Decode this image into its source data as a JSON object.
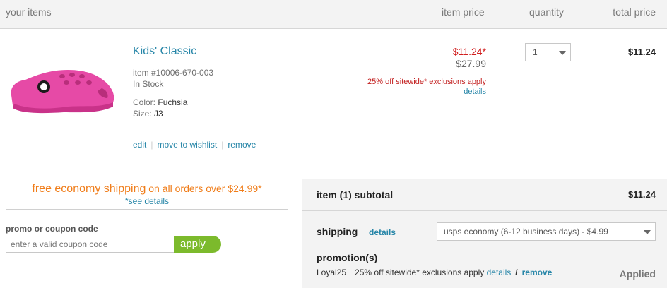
{
  "header": {
    "your_items": "your items",
    "item_price": "item price",
    "quantity": "quantity",
    "total_price": "total price"
  },
  "item": {
    "name": "Kids' Classic",
    "item_number": "item #10006-670-003",
    "stock": "In Stock",
    "color_label": "Color:",
    "color_value": "Fuchsia",
    "size_label": "Size:",
    "size_value": "J3",
    "actions": {
      "edit": "edit",
      "wishlist": "move to wishlist",
      "remove": "remove"
    },
    "sale_price": "$11.24*",
    "original_price": "$27.99",
    "promo_text": "25% off sitewide* exclusions apply",
    "promo_details": "details",
    "quantity": "1",
    "total": "$11.24",
    "image_icon": "pink-clog-image"
  },
  "shipping_banner": {
    "headline": "free economy shipping",
    "subline": " on all orders over $24.99*",
    "see_details": "*see details"
  },
  "coupon": {
    "label": "promo or coupon code",
    "placeholder": "enter a valid coupon code",
    "apply": "apply"
  },
  "summary": {
    "subtotal_label": "item (1) subtotal",
    "subtotal_value": "$11.24",
    "shipping_label": "shipping",
    "shipping_details": "details",
    "shipping_option": "usps economy (6-12 business days) - $4.99",
    "promotions_label": "promotion(s)",
    "promo_code": "Loyal25",
    "promo_description": "25% off sitewide* exclusions apply",
    "promo_details": "details",
    "promo_slash": "/",
    "promo_remove": "remove",
    "promo_status": "Applied"
  },
  "colors": {
    "link": "#2786a8",
    "sale_red": "#d11e1e",
    "shipping_orange": "#f07d1a",
    "apply_green": "#7cba2c",
    "clog_pink": "#e64aa6"
  }
}
